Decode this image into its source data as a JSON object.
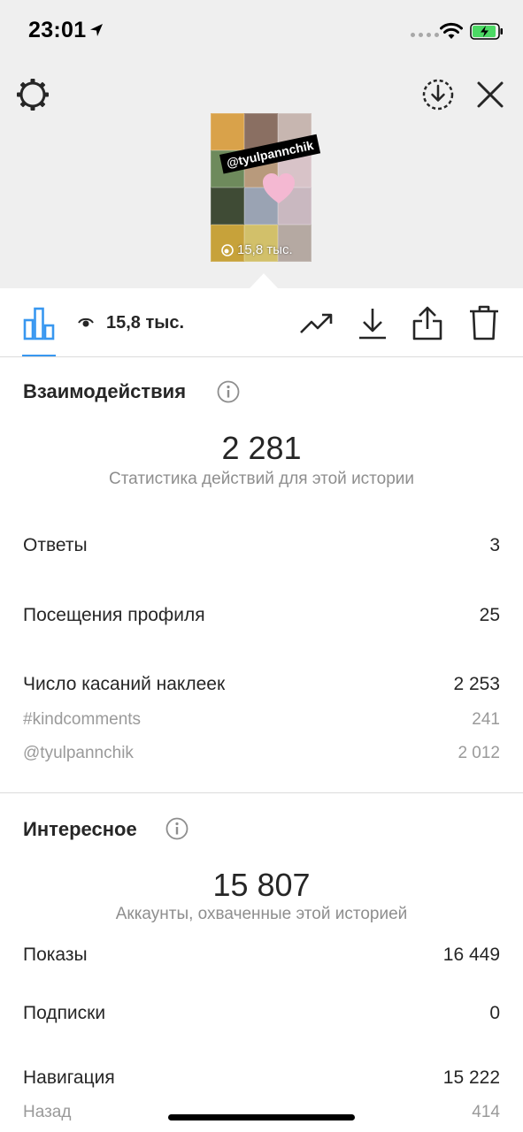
{
  "status_bar": {
    "time": "23:01"
  },
  "header": {
    "story_sticker": "@tyulpannchik",
    "story_views": "15,8 тыс."
  },
  "toolbar": {
    "views": "15,8 тыс."
  },
  "interactions": {
    "title": "Взаимодействия",
    "total": "2 281",
    "caption": "Статистика действий для этой истории",
    "rows": [
      {
        "label": "Ответы",
        "value": "3"
      },
      {
        "label": "Посещения профиля",
        "value": "25"
      },
      {
        "label": "Число касаний наклеек",
        "value": "2 253"
      }
    ],
    "sub_rows": [
      {
        "label": "#kindcomments",
        "value": "241"
      },
      {
        "label": "@tyulpannchik",
        "value": "2 012"
      }
    ]
  },
  "discovery": {
    "title": "Интересное",
    "total": "15 807",
    "caption": "Аккаунты, охваченные этой историей",
    "rows": [
      {
        "label": "Показы",
        "value": "16 449"
      },
      {
        "label": "Подписки",
        "value": "0"
      },
      {
        "label": "Навигация",
        "value": "15 222"
      }
    ],
    "sub_rows": [
      {
        "label": "Назад",
        "value": "414"
      }
    ]
  },
  "colors": {
    "accent": "#3897f0",
    "text": "#262626",
    "secondary": "#8e8e8e",
    "background_top": "#efefef"
  }
}
